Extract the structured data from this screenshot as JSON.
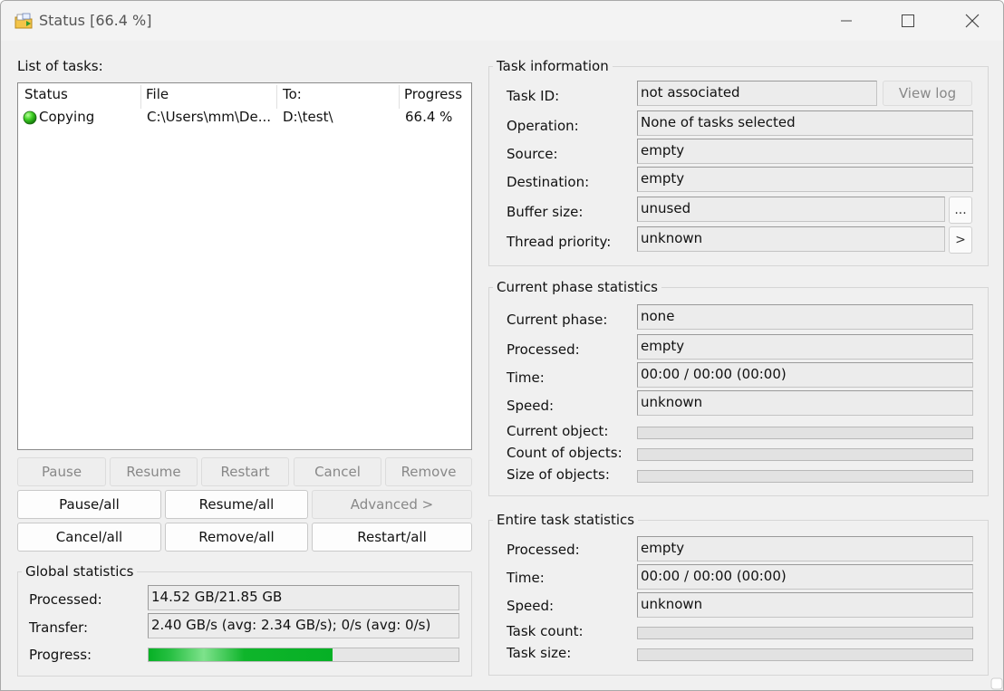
{
  "window": {
    "title": "Status [66.4 %]"
  },
  "tasks": {
    "heading": "List of tasks:",
    "columns": [
      "Status",
      "File",
      "To:",
      "Progress"
    ],
    "rows": [
      {
        "status": "Copying",
        "file": "C:\\Users\\mm\\De...",
        "to": "D:\\test\\",
        "progress": "66.4 %"
      }
    ],
    "buttons": {
      "pause": "Pause",
      "resume": "Resume",
      "restart": "Restart",
      "cancel": "Cancel",
      "remove": "Remove",
      "pause_all": "Pause/all",
      "resume_all": "Resume/all",
      "advanced": "Advanced >",
      "cancel_all": "Cancel/all",
      "remove_all": "Remove/all",
      "restart_all": "Restart/all"
    }
  },
  "global_stats": {
    "title": "Global statistics",
    "processed_label": "Processed:",
    "processed_value": "14.52 GB/21.85 GB",
    "transfer_label": "Transfer:",
    "transfer_value": "2.40 GB/s (avg: 2.34 GB/s); 0/s (avg: 0/s)",
    "progress_label": "Progress:",
    "progress_fraction": 0.594
  },
  "task_info": {
    "title": "Task information",
    "task_id_label": "Task ID:",
    "task_id_value": "not associated",
    "view_log": "View log",
    "operation_label": "Operation:",
    "operation_value": "None of tasks selected",
    "source_label": "Source:",
    "source_value": "empty",
    "destination_label": "Destination:",
    "destination_value": "empty",
    "buffer_label": "Buffer size:",
    "buffer_value": "unused",
    "buffer_btn": "...",
    "priority_label": "Thread priority:",
    "priority_value": "unknown",
    "priority_btn": ">"
  },
  "phase_stats": {
    "title": "Current phase statistics",
    "phase_label": "Current phase:",
    "phase_value": "none",
    "processed_label": "Processed:",
    "processed_value": "empty",
    "time_label": "Time:",
    "time_value": "00:00 / 00:00 (00:00)",
    "speed_label": "Speed:",
    "speed_value": "unknown",
    "object_label": "Current object:",
    "count_label": "Count of objects:",
    "size_label": "Size of objects:"
  },
  "entire_stats": {
    "title": "Entire task statistics",
    "processed_label": "Processed:",
    "processed_value": "empty",
    "time_label": "Time:",
    "time_value": "00:00 / 00:00 (00:00)",
    "speed_label": "Speed:",
    "speed_value": "unknown",
    "count_label": "Task count:",
    "size_label": "Task size:"
  },
  "colors": {
    "progress": "#06b025",
    "status_ok": "#2fc41f"
  },
  "icons": [
    "app-icon",
    "minimize-icon",
    "maximize-icon",
    "close-icon",
    "status-green-icon"
  ]
}
